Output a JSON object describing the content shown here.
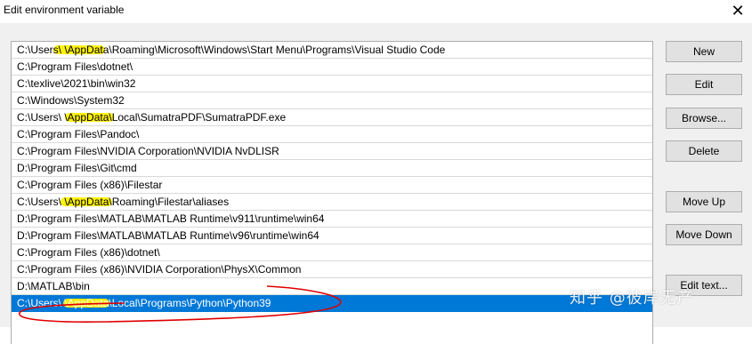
{
  "window": {
    "title": "Edit environment variable",
    "close_glyph": "✕"
  },
  "paths": [
    "C:\\Users\\          \\AppData\\Roaming\\Microsoft\\Windows\\Start Menu\\Programs\\Visual Studio Code",
    "C:\\Program Files\\dotnet\\",
    "C:\\texlive\\2021\\bin\\win32",
    "C:\\Windows\\System32",
    "C:\\Users\\          \\AppData\\Local\\SumatraPDF\\SumatraPDF.exe",
    "C:\\Program Files\\Pandoc\\",
    "C:\\Program Files\\NVIDIA Corporation\\NVIDIA NvDLISR",
    "D:\\Program Files\\Git\\cmd",
    "C:\\Program Files (x86)\\Filestar",
    "C:\\Users\\          \\AppData\\Roaming\\Filestar\\aliases",
    "D:\\Program Files\\MATLAB\\MATLAB Runtime\\v911\\runtime\\win64",
    "D:\\Program Files\\MATLAB\\MATLAB Runtime\\v96\\runtime\\win64",
    "C:\\Program Files (x86)\\dotnet\\",
    "C:\\Program Files (x86)\\NVIDIA Corporation\\PhysX\\Common",
    "D:\\MATLAB\\bin",
    "C:\\Users\\          \\AppData\\Local\\Programs\\Python\\Python39"
  ],
  "selected_index": 15,
  "buttons": {
    "new": "New",
    "edit": "Edit",
    "browse": "Browse...",
    "delete": "Delete",
    "move_up": "Move Up",
    "move_down": "Move Down",
    "edit_text": "Edit text..."
  },
  "watermark": "知乎 @彼岸无产",
  "colors": {
    "selection": "#0078d7",
    "highlighter": "#fff200",
    "annotation": "#e00000"
  }
}
